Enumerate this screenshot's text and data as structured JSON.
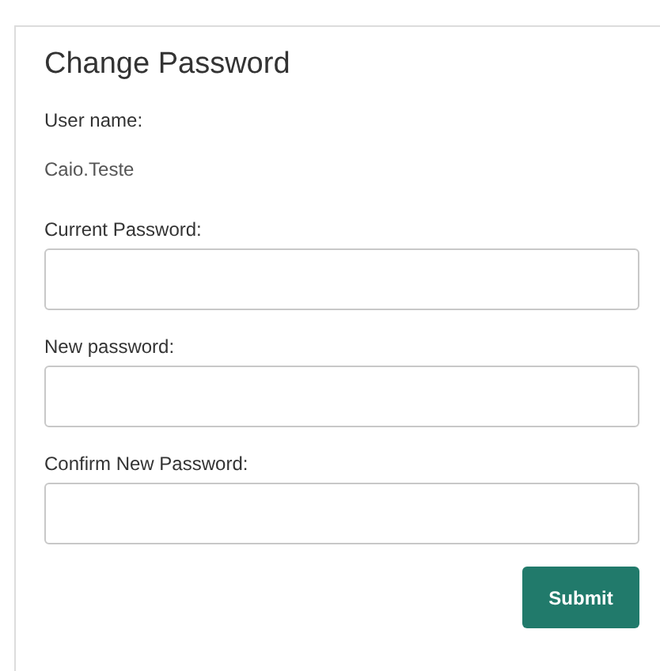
{
  "title": "Change Password",
  "user": {
    "label": "User name:",
    "value": "Caio.Teste"
  },
  "fields": [
    {
      "label": "Current Password:"
    },
    {
      "label": "New password:"
    },
    {
      "label": "Confirm New Password:"
    }
  ],
  "submit": "Submit"
}
